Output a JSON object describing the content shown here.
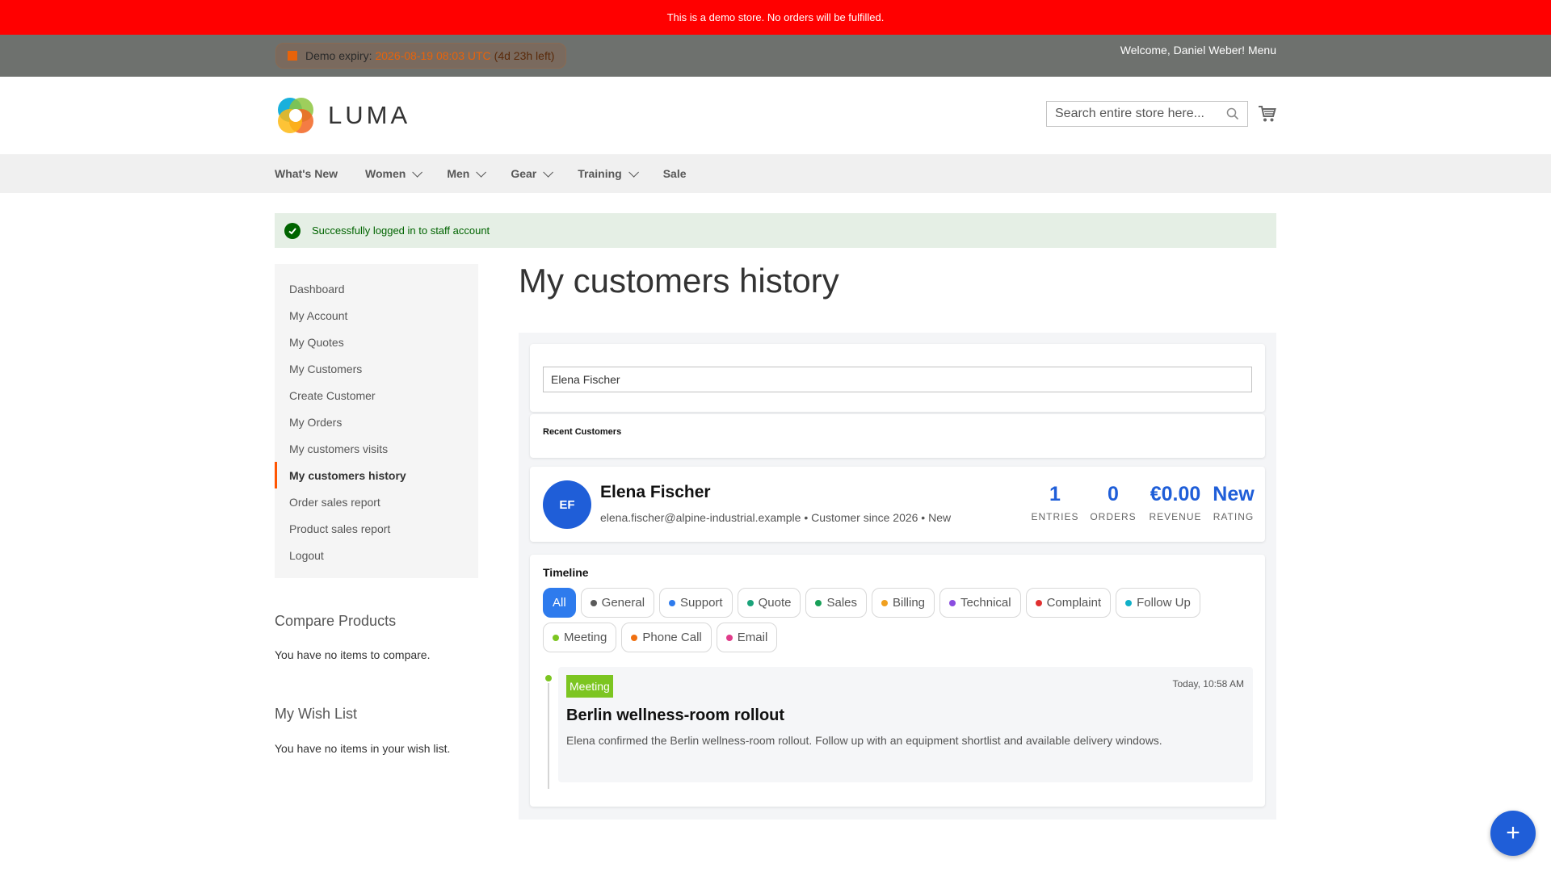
{
  "demo_notice": "This is a demo store. No orders will be fulfilled.",
  "panel": {
    "expiry_label": "Demo expiry:",
    "expiry_date": "2026-08-19 08:03 UTC",
    "expiry_left": "(4d 23h left)",
    "welcome": "Welcome, Daniel Weber!",
    "menu": "Menu"
  },
  "header": {
    "logo_text": "LUMA",
    "search_placeholder": "Search entire store here..."
  },
  "nav": {
    "items": [
      {
        "label": "What's New",
        "has_dropdown": false
      },
      {
        "label": "Women",
        "has_dropdown": true
      },
      {
        "label": "Men",
        "has_dropdown": true
      },
      {
        "label": "Gear",
        "has_dropdown": true
      },
      {
        "label": "Training",
        "has_dropdown": true
      },
      {
        "label": "Sale",
        "has_dropdown": false
      }
    ]
  },
  "message": {
    "success": "Successfully logged in to staff account"
  },
  "sidebar": {
    "items": [
      {
        "label": "Dashboard",
        "active": false
      },
      {
        "label": "My Account",
        "active": false
      },
      {
        "label": "My Quotes",
        "active": false
      },
      {
        "label": "My Customers",
        "active": false
      },
      {
        "label": "Create Customer",
        "active": false
      },
      {
        "label": "My Orders",
        "active": false
      },
      {
        "label": "My customers visits",
        "active": false
      },
      {
        "label": "My customers history",
        "active": true
      },
      {
        "label": "Order sales report",
        "active": false
      },
      {
        "label": "Product sales report",
        "active": false
      },
      {
        "label": "Logout",
        "active": false
      }
    ],
    "compare": {
      "title": "Compare Products",
      "text": "You have no items to compare."
    },
    "wishlist": {
      "title": "My Wish List",
      "text": "You have no items in your wish list."
    }
  },
  "page": {
    "title": "My customers history",
    "search_value": "Elena Fischer",
    "recent_title": "Recent Customers"
  },
  "customer": {
    "initials": "EF",
    "name": "Elena Fischer",
    "meta": "elena.fischer@alpine-industrial.example • Customer since 2026 • New",
    "stats": [
      {
        "value": "1",
        "label": "ENTRIES"
      },
      {
        "value": "0",
        "label": "ORDERS"
      },
      {
        "value": "€0.00",
        "label": "REVENUE"
      },
      {
        "value": "New",
        "label": "RATING"
      }
    ]
  },
  "timeline": {
    "title": "Timeline",
    "filters": [
      {
        "label": "All",
        "color": "",
        "active": true
      },
      {
        "label": "General",
        "color": "#5a5a5a",
        "active": false
      },
      {
        "label": "Support",
        "color": "#2e7bed",
        "active": false
      },
      {
        "label": "Quote",
        "color": "#1aa37a",
        "active": false
      },
      {
        "label": "Sales",
        "color": "#18a058",
        "active": false
      },
      {
        "label": "Billing",
        "color": "#f0a020",
        "active": false
      },
      {
        "label": "Technical",
        "color": "#8a4de0",
        "active": false
      },
      {
        "label": "Complaint",
        "color": "#e03030",
        "active": false
      },
      {
        "label": "Follow Up",
        "color": "#10b0c8",
        "active": false
      },
      {
        "label": "Meeting",
        "color": "#7cc521",
        "active": false
      },
      {
        "label": "Phone Call",
        "color": "#f07010",
        "active": false
      },
      {
        "label": "Email",
        "color": "#e03c8a",
        "active": false
      }
    ],
    "entries": [
      {
        "type": "Meeting",
        "type_color": "#7cc521",
        "time": "Today, 10:58 AM",
        "title": "Berlin wellness-room rollout",
        "body": "Elena confirmed the Berlin wellness-room rollout. Follow up with an equipment shortlist and available delivery windows."
      }
    ]
  },
  "fab_label": "+"
}
